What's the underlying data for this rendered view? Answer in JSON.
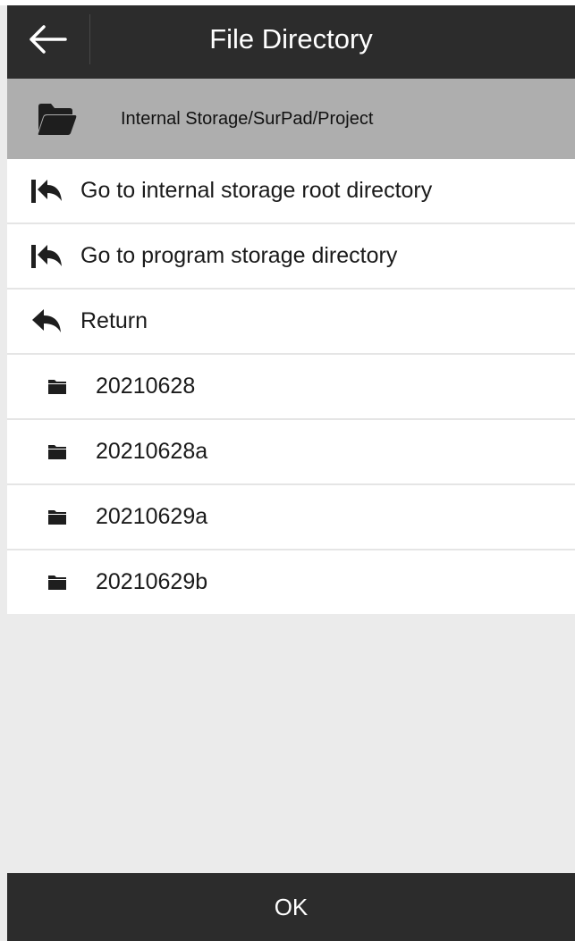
{
  "header": {
    "title": "File Directory",
    "back_icon": "arrow-left-icon"
  },
  "path": {
    "text": "Internal Storage/SurPad/Project",
    "icon": "folder-open-icon"
  },
  "nav": [
    {
      "label": "Go to internal storage root directory",
      "icon": "reply-to-start-icon"
    },
    {
      "label": "Go to program storage directory",
      "icon": "reply-to-start-icon"
    },
    {
      "label": "Return",
      "icon": "reply-icon"
    }
  ],
  "folders": [
    {
      "name": "20210628",
      "icon": "folder-icon"
    },
    {
      "name": "20210628a",
      "icon": "folder-icon"
    },
    {
      "name": "20210629a",
      "icon": "folder-icon"
    },
    {
      "name": "20210629b",
      "icon": "folder-icon"
    }
  ],
  "footer": {
    "ok_label": "OK"
  },
  "colors": {
    "bar_background": "#2c2c2c",
    "path_background": "#aeaeae",
    "list_background": "#ffffff",
    "empty_background": "#ebebeb",
    "text": "#1a1a1a"
  }
}
